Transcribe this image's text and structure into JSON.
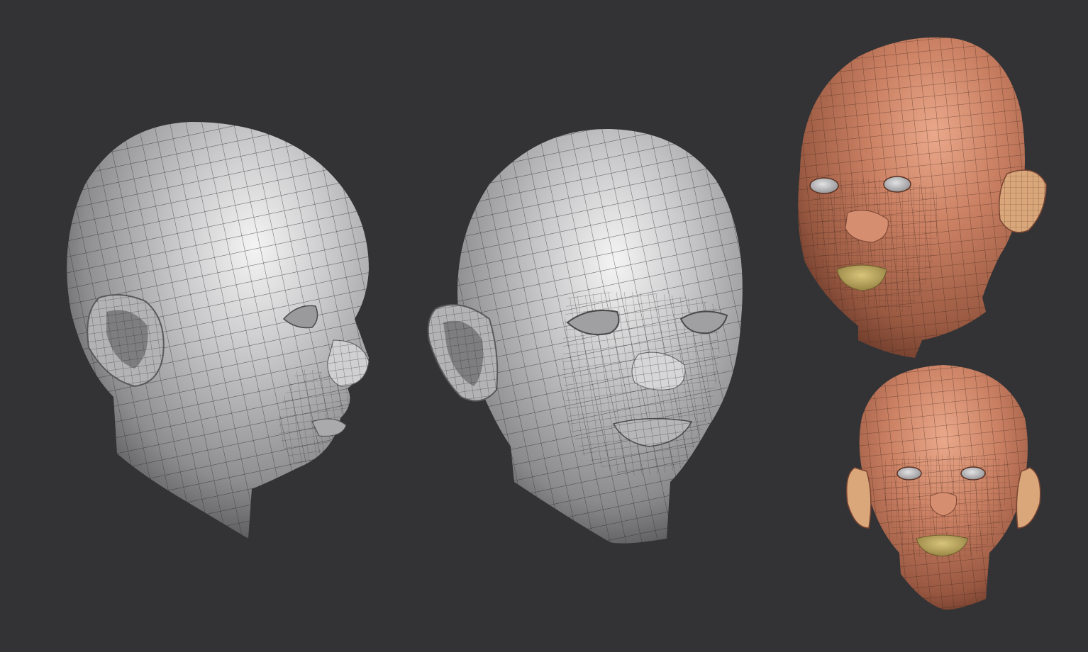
{
  "scene": {
    "background": "#333335",
    "views": [
      {
        "id": "side-profile",
        "material": "grey-clay",
        "base": "#b9b9bb",
        "light": "#f2f2f2",
        "dark": "#4a4a4c",
        "wire": "#2a2a2c"
      },
      {
        "id": "front-three-quarter",
        "material": "grey-clay",
        "base": "#b9b9bb",
        "light": "#f2f2f2",
        "dark": "#4a4a4c",
        "wire": "#2a2a2c"
      },
      {
        "id": "polygroup-three-quarter",
        "material": "polygroups",
        "base": "#c47a5e",
        "light": "#e6a083",
        "dark": "#7a4432",
        "wire": "#3a2218",
        "lips": "#b8a25e",
        "ears": "#d9a77a"
      },
      {
        "id": "polygroup-front",
        "material": "polygroups",
        "base": "#c47a5e",
        "light": "#e6a083",
        "dark": "#7a4432",
        "wire": "#3a2218",
        "lips": "#b8a25e",
        "ears": "#d9a77a"
      }
    ]
  }
}
